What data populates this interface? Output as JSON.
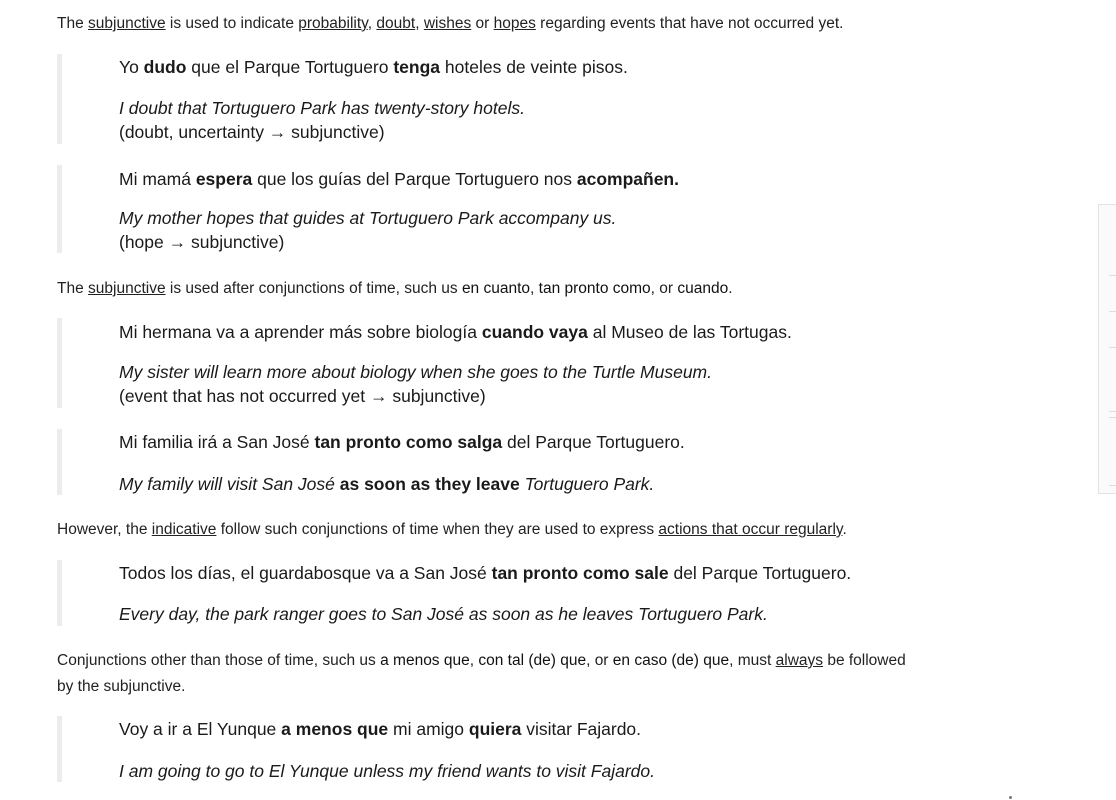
{
  "p1": {
    "t1": "The ",
    "u1": "subjunctive",
    "t2": " is used to indicate ",
    "u2": "probability",
    "t3": ", ",
    "u3": "doubt",
    "t4": ", ",
    "u4": "wishes",
    "t5": " or ",
    "u5": "hopes",
    "t6": " regarding events that have not occurred yet."
  },
  "ex1": {
    "a": "Yo ",
    "b": "dudo",
    "c": " que el Parque Tortuguero ",
    "d": "tenga",
    "e": " hoteles de veinte pisos.",
    "translation": "I doubt that Tortuguero Park has twenty-story hotels.",
    "note": "(doubt, uncertainty → subjunctive)"
  },
  "ex2": {
    "a": "Mi mamá ",
    "b": "espera",
    "c": " que los guías del Parque Tortuguero nos ",
    "d": "acompañen.",
    "translation": "My mother hopes that guides at Tortuguero Park accompany us.",
    "note": "(hope → subjunctive)"
  },
  "p2": {
    "t1": "The ",
    "u1": "subjunctive",
    "t2": " is used after conjunctions of time, such us ",
    "b1": "en cuanto",
    "t3": ", ",
    "b2": "tan pronto como",
    "t4": ", or ",
    "b3": "cuando",
    "t5": "."
  },
  "ex3": {
    "a": "Mi hermana va a aprender más sobre biología ",
    "b": "cuando vaya",
    "c": " al Museo de las Tortugas.",
    "translation": "My sister will learn more about biology when she goes to the Turtle Museum.",
    "note": "(event that has not occurred yet → subjunctive)"
  },
  "ex4": {
    "a": "Mi familia irá a San José ",
    "b": "tan pronto como salga",
    "c": " del Parque Tortuguero.",
    "ta": "My family will visit San José ",
    "tb": "as soon as they leave",
    "tc": " Tortuguero Park."
  },
  "p3": {
    "t1": "However, the ",
    "u1": "indicative",
    "t2": " follow such conjunctions of time when they are used to express ",
    "u2": "actions that occur regularly",
    "t3": "."
  },
  "ex5": {
    "a": "Todos los días, el guardabosque va a San José ",
    "b": "tan pronto como sale",
    "c": " del Parque Tortuguero.",
    "translation": "Every day, the park ranger goes to San José as soon as he leaves Tortuguero Park."
  },
  "p4": {
    "t1": "Conjunctions other than those of time, such us ",
    "b1": "a menos que",
    "t2": ", ",
    "b2": "con tal (de) que",
    "t3": ", or ",
    "b3": "en caso (de) que",
    "t4": ", must ",
    "u1": "always",
    "t5": " be followed",
    "t6": "by the subjunctive."
  },
  "ex6": {
    "a": "Voy a ir a El Yunque ",
    "b": "a menos que",
    "c": " mi amigo ",
    "d": "quiera",
    "e": " visitar Fajardo.",
    "translation": "I am going to go to El Yunque unless my friend wants to visit Fajardo."
  }
}
